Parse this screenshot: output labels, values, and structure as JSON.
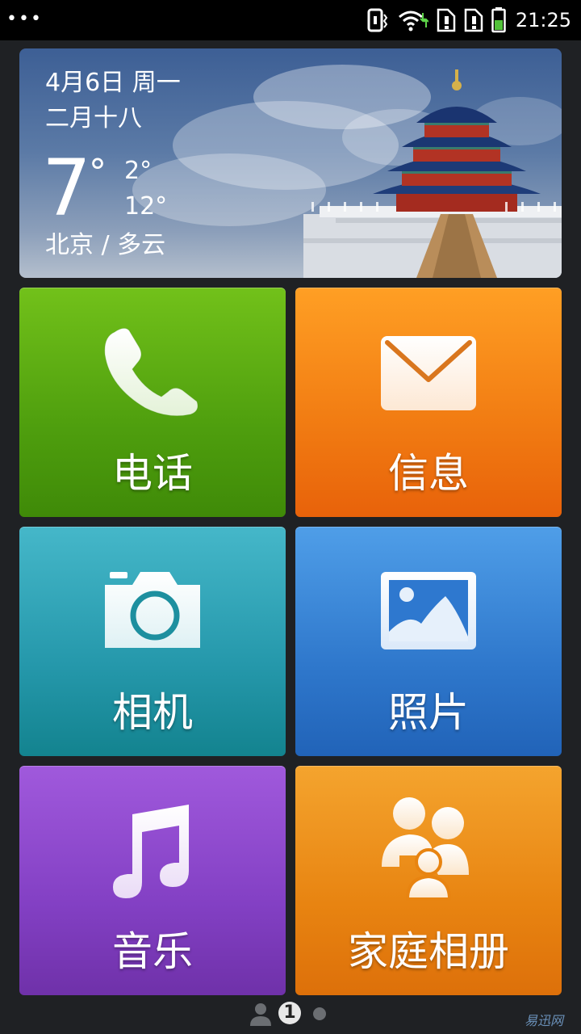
{
  "status_bar": {
    "menu_dots": "•••",
    "time": "21:25",
    "icons": [
      "vibrate-icon",
      "wifi-icon",
      "sim1-alert-icon",
      "sim2-alert-icon",
      "battery-icon"
    ]
  },
  "weather": {
    "date": "4月6日 周一",
    "lunar_date": "二月十八",
    "temperature": "7",
    "degree_symbol": "°",
    "low": "2°",
    "high": "12°",
    "city_condition": "北京 / 多云"
  },
  "tiles": {
    "phone": {
      "label": "电话",
      "icon": "phone-icon",
      "color": "#5aac12"
    },
    "messages": {
      "label": "信息",
      "icon": "envelope-icon",
      "color": "#f2761a"
    },
    "camera": {
      "label": "相机",
      "icon": "camera-icon",
      "color": "#2a9cb0"
    },
    "photos": {
      "label": "照片",
      "icon": "picture-icon",
      "color": "#3383d6"
    },
    "music": {
      "label": "音乐",
      "icon": "music-note-icon",
      "color": "#8a45c9"
    },
    "family_album": {
      "label": "家庭相册",
      "icon": "family-icon",
      "color": "#ea8614"
    }
  },
  "pager": {
    "current_page": "1",
    "total_page_dots": 2
  },
  "watermark": "易迅网"
}
